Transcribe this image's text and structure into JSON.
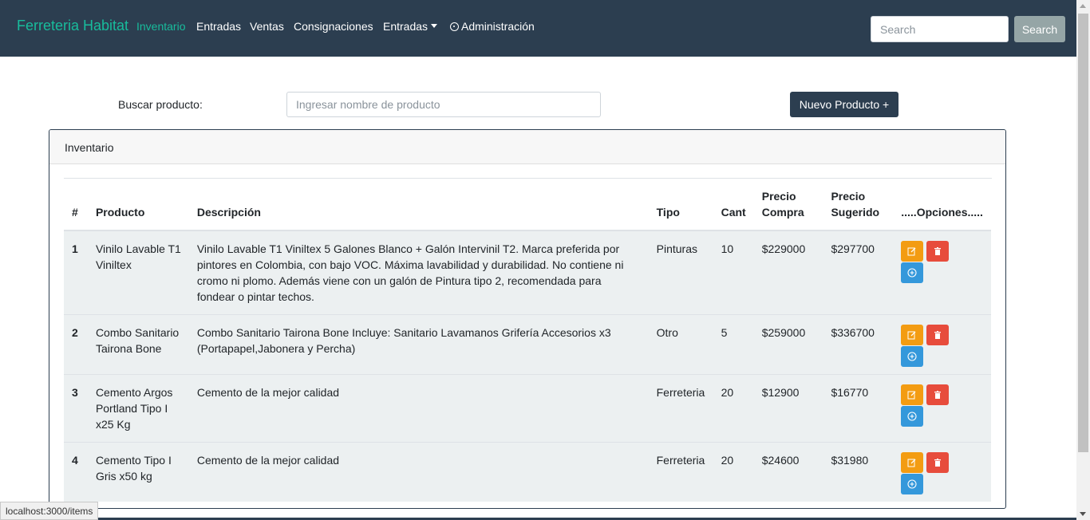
{
  "navbar": {
    "brand": "Ferreteria Habitat",
    "links": [
      "Inventario",
      "Entradas",
      "Ventas",
      "Consignaciones"
    ],
    "dropdown_label": "Entradas",
    "admin_label": "Administración",
    "search_placeholder": "Search",
    "search_button": "Search"
  },
  "toolbar": {
    "buscar_label": "Buscar producto:",
    "buscar_placeholder": "Ingresar nombre de producto",
    "nuevo_button": "Nuevo Producto +"
  },
  "card": {
    "title": "Inventario",
    "columns": {
      "num": "#",
      "producto": "Producto",
      "descripcion": "Descripción",
      "tipo": "Tipo",
      "cant": "Cant",
      "precio_compra": "Precio Compra",
      "precio_sugerido": "Precio Sugerido",
      "opciones": ".....Opciones....."
    },
    "rows": [
      {
        "num": "1",
        "producto": "Vinilo Lavable T1 Viniltex",
        "descripcion": "Vinilo Lavable T1 Viniltex 5 Galones Blanco + Galón Intervinil T2. Marca preferida por pintores en Colombia, con bajo VOC. Máxima lavabilidad y durabilidad. No contiene ni cromo ni plomo. Además viene con un galón de Pintura tipo 2, recomendada para fondear o pintar techos.",
        "tipo": "Pinturas",
        "cant": "10",
        "precio_compra": "$229000",
        "precio_sugerido": "$297700"
      },
      {
        "num": "2",
        "producto": "Combo Sanitario Tairona Bone",
        "descripcion": "Combo Sanitario Tairona Bone Incluye: Sanitario Lavamanos Grifería Accesorios x3 (Portapapel,Jabonera y Percha)",
        "tipo": "Otro",
        "cant": "5",
        "precio_compra": "$259000",
        "precio_sugerido": "$336700"
      },
      {
        "num": "3",
        "producto": "Cemento Argos Portland Tipo I x25 Kg",
        "descripcion": "Cemento de la mejor calidad",
        "tipo": "Ferreteria",
        "cant": "20",
        "precio_compra": "$12900",
        "precio_sugerido": "$16770"
      },
      {
        "num": "4",
        "producto": "Cemento Tipo I Gris x50 kg",
        "descripcion": "Cemento de la mejor calidad",
        "tipo": "Ferreteria",
        "cant": "20",
        "precio_compra": "$24600",
        "precio_sugerido": "$31980"
      }
    ]
  },
  "statusbar": {
    "url": "localhost:3000/items"
  },
  "colors": {
    "navbar": "#2c3e50",
    "accent": "#18bc9c",
    "edit": "#f39c12",
    "delete": "#e74c3c",
    "add": "#3498db"
  }
}
